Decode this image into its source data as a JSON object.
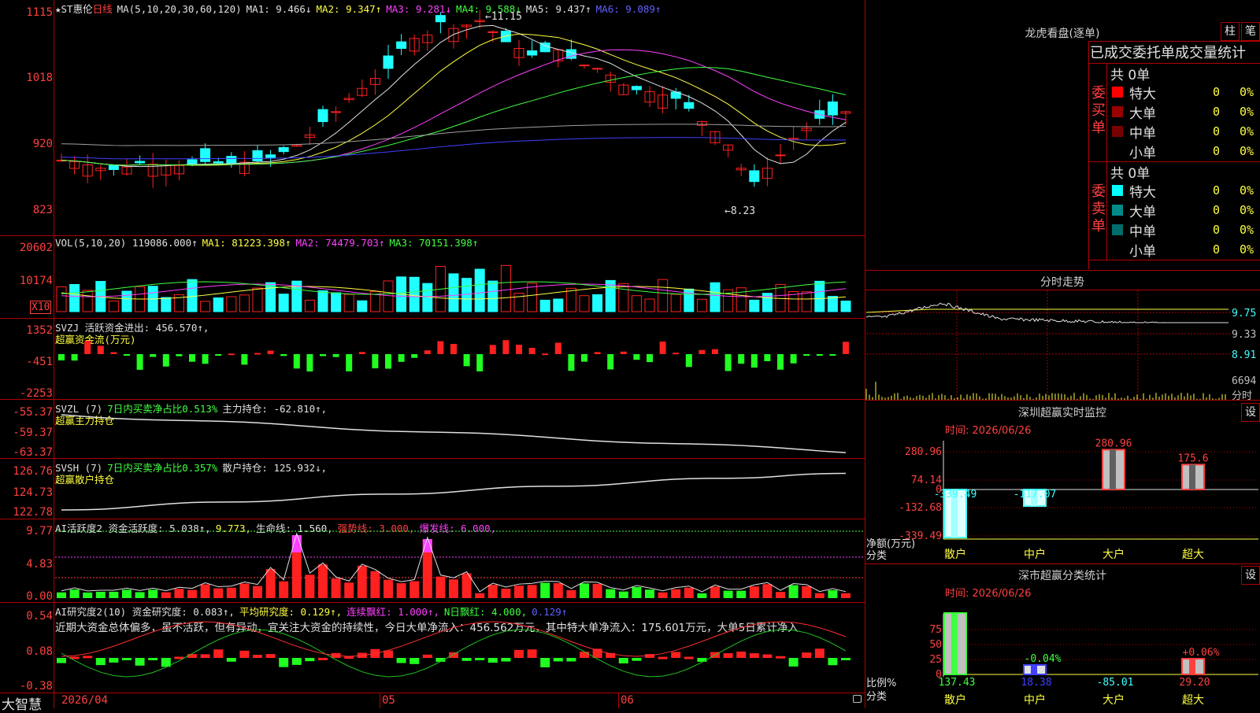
{
  "main_chart": {
    "title_star": "★",
    "stock": "ST惠伦",
    "period": "日线",
    "ma_params": "MA(5,10,20,30,60,120)",
    "ma1": "MA1: 9.466↓",
    "ma2": "MA2: 9.347↑",
    "ma3": "MA3: 9.281↓",
    "ma4": "MA4: 9.588↓",
    "ma5": "MA5: 9.437↑",
    "ma6": "MA6: 9.089↑",
    "high_label": "11.15",
    "low_label": "8.23",
    "y_axis": [
      "1115",
      "1018",
      "920",
      "823"
    ]
  },
  "volume_panel": {
    "header": "VOL(5,10,20) 119086.000↑",
    "ma1": "MA1: 81223.398↑",
    "ma2": "MA2: 74479.703↑",
    "ma3": "MA3: 70151.398↑",
    "y_axis": [
      "20602",
      "10174"
    ],
    "unit": "X10"
  },
  "svzj_panel": {
    "header": "SVZJ  活跃资金进出: 456.570↑,",
    "subtitle": "超赢资金流(万元)",
    "y_axis": [
      "1352",
      "-451",
      "-2253"
    ]
  },
  "svzl_panel": {
    "header_a": "SVZL (7)",
    "header_b": "7日内买卖净占比0.513%",
    "header_c": "主力持仓: -62.810↑,",
    "subtitle": "超赢主力持仓",
    "y_axis": [
      "-55.37",
      "-59.37",
      "-63.37"
    ]
  },
  "svsh_panel": {
    "header_a": "SVSH (7)",
    "header_b": "7日内买卖净占比0.357%",
    "header_c": "散户持仓: 125.932↓,",
    "subtitle": "超赢散户持仓",
    "y_axis": [
      "126.76",
      "124.73",
      "122.78"
    ]
  },
  "ai_active_panel": {
    "header_a": "AI活跃度2 资金活跃度: 5.038↑,",
    "header_b": "9.773,",
    "header_c": "生命线: 1.560,",
    "header_d": "强势线: 3.000,",
    "header_e": "爆发线: 6.000,",
    "y_axis": [
      "9.77",
      "4.83",
      "0.00"
    ]
  },
  "ai_research_panel": {
    "header_a": "AI研究度2(10) 资金研究度: 0.083↑,",
    "header_b": "平均研究度: 0.129↑,",
    "header_c": "连续飘红: 1.000↑,",
    "header_d": "N日飘红: 4.000,",
    "header_e": "0.129↑",
    "comment": "近期大资金总体偏多，虽不活跃，但有异动，宜关注大资金的持续性，今日大单净流入：456.562万元，其中特大单净流入：175.601万元，大单5日累计净入",
    "y_axis": [
      "0.54",
      "0.08",
      "-0.38"
    ]
  },
  "bottom_axis": {
    "app_name": "大智慧",
    "date_start": "2026/04",
    "month_05": "05",
    "month_06": "06"
  },
  "dragon_tiger": {
    "title": "龙虎看盘(逐单)",
    "btn_bar": "柱",
    "btn_pen": "笔",
    "subtitle": "已成交委托单成交量统计",
    "buy_label": "委买单",
    "sell_label": "委卖单",
    "buy_total": "共 0单",
    "sell_total": "共 0单",
    "rows": [
      "特大",
      "大单",
      "中单",
      "小单"
    ],
    "zero": "0",
    "pct": "0%",
    "buy_colors": [
      "#ff0000",
      "#990000",
      "#770000",
      "#000000"
    ],
    "sell_colors": [
      "#00ffff",
      "#008b8b",
      "#006d6d",
      "#000000"
    ]
  },
  "intraday": {
    "title": "分时走势",
    "y_axis": [
      "9.75",
      "9.33",
      "8.91",
      "6694"
    ],
    "unit": "分时"
  },
  "realtime_monitor": {
    "title": "深圳超赢实时监控",
    "btn": "设",
    "time": "时间: 2026/06/26",
    "y_axis": [
      "280.96",
      "74.14",
      "0",
      "-132.68",
      "-339.49"
    ],
    "bars": [
      {
        "name": "散户",
        "value": -339.49,
        "label": "-339.49"
      },
      {
        "name": "中户",
        "value": -117.07,
        "label": "-117.07"
      },
      {
        "name": "大户",
        "value": 280.96,
        "label": "280.96"
      },
      {
        "name": "超大",
        "value": 175.6,
        "label": "175.6"
      }
    ],
    "ylabel": "净额(万元)",
    "xlabel": "分类"
  },
  "classification_stats": {
    "title": "深市超赢分类统计",
    "btn": "设",
    "time": "时间: 2026/06/26",
    "y_axis": [
      "75",
      "50",
      "25",
      "0"
    ],
    "bars": [
      {
        "name": "散户",
        "value": 137.43,
        "top_label": "",
        "bottom_label": "137.43"
      },
      {
        "name": "中户",
        "value": 18.38,
        "top_label": "-0.04%",
        "bottom_label": "18.38"
      },
      {
        "name": "大户",
        "value": -85.01,
        "top_label": "",
        "bottom_label": "-85.01"
      },
      {
        "name": "超大",
        "value": 29.2,
        "top_label": "+0.06%",
        "bottom_label": "29.20"
      }
    ],
    "ylabel": "比例%",
    "xlabel": "分类"
  },
  "colors": {
    "up": "#ff2020",
    "down": "#20ffff",
    "grid": "#b00000"
  }
}
